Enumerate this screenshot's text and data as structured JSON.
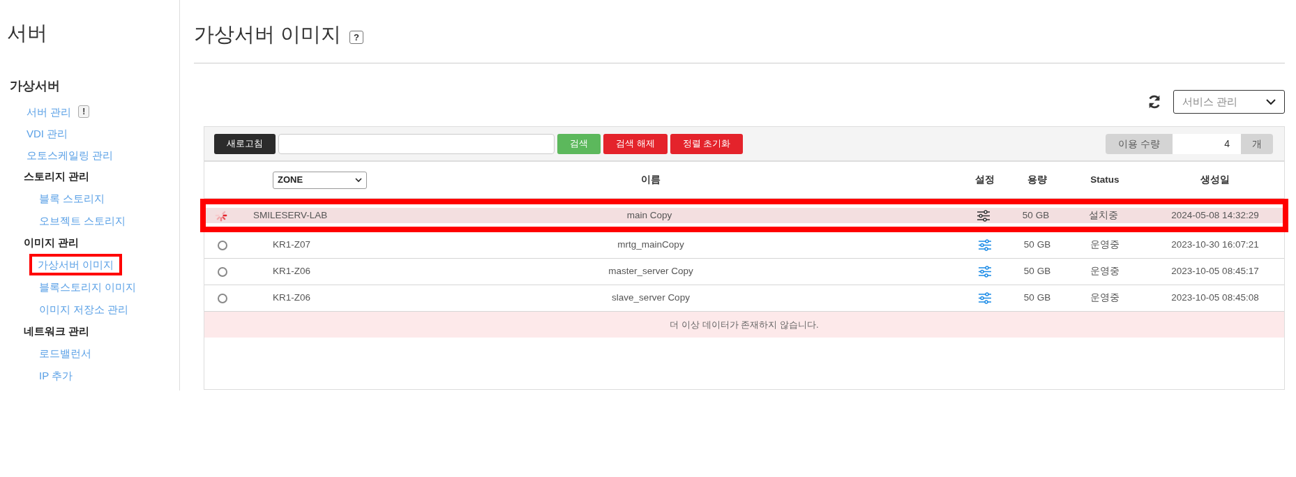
{
  "sidebar": {
    "title": "서버",
    "section_title": "가상서버",
    "items": [
      {
        "kind": "link",
        "label": "서버 관리",
        "badge": "!",
        "highlighted": false
      },
      {
        "kind": "link",
        "label": "VDI 관리",
        "highlighted": false
      },
      {
        "kind": "link",
        "label": "오토스케일링 관리",
        "highlighted": false
      },
      {
        "kind": "group",
        "label": "스토리지 관리",
        "children": [
          {
            "label": "블록 스토리지",
            "highlighted": false
          },
          {
            "label": "오브젝트 스토리지",
            "highlighted": false
          }
        ]
      },
      {
        "kind": "group",
        "label": "이미지 관리",
        "children": [
          {
            "label": "가상서버 이미지",
            "highlighted": true
          },
          {
            "label": "블록스토리지 이미지",
            "highlighted": false
          },
          {
            "label": "이미지 저장소 관리",
            "highlighted": false
          }
        ]
      },
      {
        "kind": "group",
        "label": "네트워크 관리",
        "children": [
          {
            "label": "로드밸런서",
            "highlighted": false
          },
          {
            "label": "IP 추가",
            "highlighted": false
          }
        ]
      }
    ]
  },
  "page": {
    "title": "가상서버 이미지",
    "help_badge": "?"
  },
  "service_select": {
    "placeholder": "서비스 관리"
  },
  "toolbar": {
    "buttons_before": [
      {
        "label": "새로고침",
        "kind": "dark"
      }
    ],
    "buttons_after": [
      {
        "label": "검색",
        "kind": "success"
      },
      {
        "label": "검색 해제",
        "kind": "danger"
      },
      {
        "label": "정렬 초기화",
        "kind": "danger"
      }
    ],
    "usage": {
      "label": "이용 수량",
      "value": "4",
      "unit": "개"
    }
  },
  "table": {
    "zone_filter": "ZONE",
    "columns": [
      "이름",
      "설정",
      "용량",
      "Status",
      "생성일"
    ],
    "rows": [
      {
        "kind": "installing",
        "highlighted": true,
        "zone": "SMILESERV-LAB",
        "name": "main Copy",
        "size": "50 GB",
        "status": "설치중",
        "created": "2024-05-08 14:32:29"
      },
      {
        "kind": "ready",
        "selected": false,
        "highlighted": false,
        "zone": "KR1-Z07",
        "name": "mrtg_mainCopy",
        "size": "50 GB",
        "status": "운영중",
        "created": "2023-10-30 16:07:21"
      },
      {
        "kind": "ready",
        "selected": false,
        "highlighted": false,
        "zone": "KR1-Z06",
        "name": "master_server Copy",
        "size": "50 GB",
        "status": "운영중",
        "created": "2023-10-05 08:45:17"
      },
      {
        "kind": "ready",
        "selected": false,
        "highlighted": false,
        "zone": "KR1-Z06",
        "name": "slave_server Copy",
        "size": "50 GB",
        "status": "운영중",
        "created": "2023-10-05 08:45:08"
      }
    ],
    "empty_message": "더 이상 데이터가 존재하지 않습니다."
  }
}
